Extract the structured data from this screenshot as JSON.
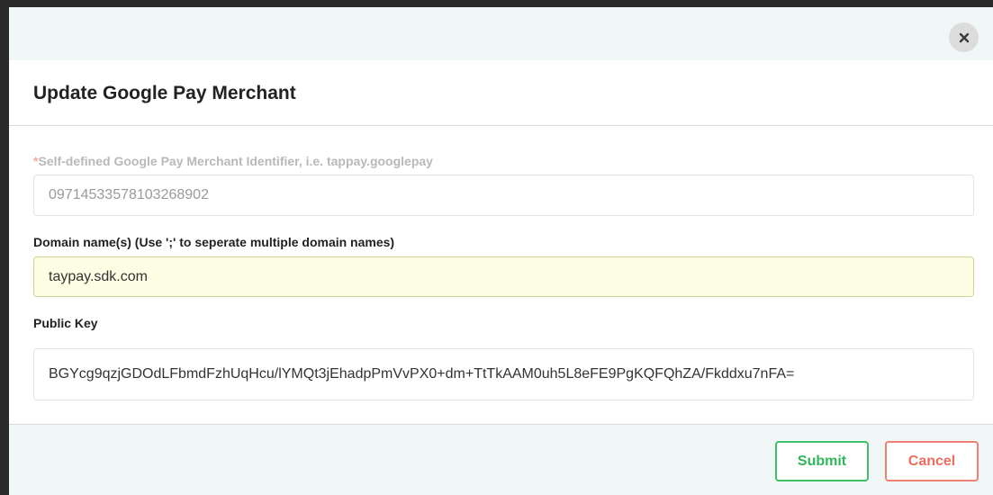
{
  "modal": {
    "title": "Update Google Pay Merchant",
    "close_icon": "close-icon"
  },
  "fields": {
    "merchant_id": {
      "required_mark": "*",
      "label": "Self-defined Google Pay Merchant Identifier, i.e. tappay.googlepay",
      "value": "09714533578103268902",
      "disabled": true
    },
    "domain_names": {
      "label": "Domain name(s) (Use ';' to seperate multiple domain names)",
      "value": "taypay.sdk.com"
    },
    "public_key": {
      "label": "Public Key",
      "value": "BGYcg9qzjGDOdLFbmdFzhUqHcu/lYMQt3jEhadpPmVvPX0+dm+TtTkAAM0uh5L8eFE9PgKQFQhZA/Fkddxu7nFA="
    }
  },
  "footer": {
    "submit_label": "Submit",
    "cancel_label": "Cancel"
  },
  "colors": {
    "submit": "#3ec16a",
    "cancel": "#f08073",
    "focused_field_bg": "#fcfde2",
    "band_bg": "#f1f6f7"
  }
}
